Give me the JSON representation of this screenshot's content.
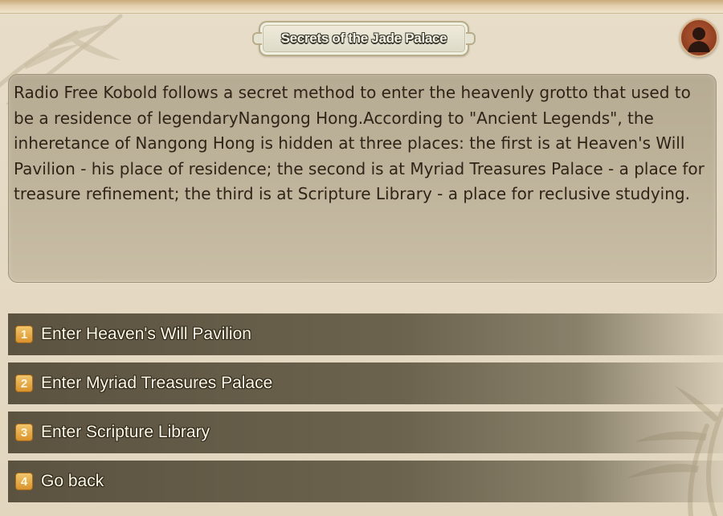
{
  "header": {
    "title": "Secrets of the Jade Palace",
    "avatar_icon": "player-silhouette-icon"
  },
  "dialog": {
    "text": "Radio Free Kobold follows a secret method to enter the heavenly grotto that used to be a residence of legendaryNangong Hong.According to \"Ancient Legends\", the inheretance of Nangong Hong is hidden at three places: the first is at Heaven's Will Pavilion - his place of residence; the second is at Myriad Treasures Palace - a place for treasure refinement; the third is at Scripture Library - a place for reclusive studying."
  },
  "options": [
    {
      "number": "1",
      "label": "Enter Heaven's Will Pavilion"
    },
    {
      "number": "2",
      "label": "Enter Myriad Treasures Palace"
    },
    {
      "number": "3",
      "label": "Enter Scripture Library"
    },
    {
      "number": "4",
      "label": "Go back"
    }
  ],
  "colors": {
    "background": "#e4d9c3",
    "option_bar": "#5b5340",
    "number_badge": "#e3a443",
    "avatar": "#9c4526"
  }
}
